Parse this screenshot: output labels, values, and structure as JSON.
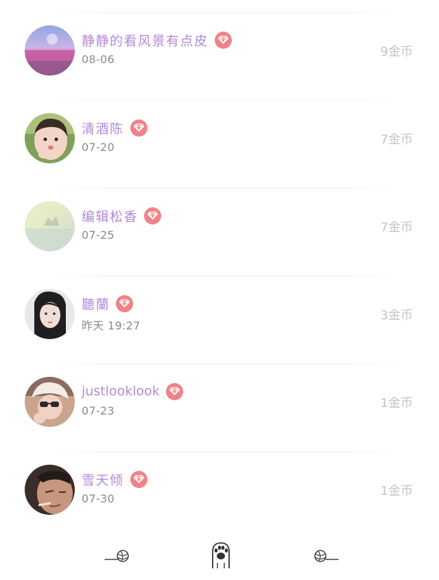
{
  "entries": [
    {
      "name": "静静的看风景有点皮",
      "date": "08-06",
      "coins": "9金币",
      "vip_icon": "diamond-icon"
    },
    {
      "name": "清酒陈",
      "date": "07-20",
      "coins": "7金币",
      "vip_icon": "diamond-icon"
    },
    {
      "name": "编辑松香",
      "date": "07-25",
      "coins": "7金币",
      "vip_icon": "diamond-icon"
    },
    {
      "name": "聽蘭",
      "date": "昨天 19:27",
      "coins": "3金币",
      "vip_icon": "diamond-icon"
    },
    {
      "name": "justlooklook",
      "date": "07-23",
      "coins": "1金币",
      "vip_icon": "diamond-icon"
    },
    {
      "name": "雪天倾",
      "date": "07-30",
      "coins": "1金币",
      "vip_icon": "diamond-icon"
    }
  ],
  "tabbar": {
    "left_icon": "yarn-ball-icon",
    "center_icon": "cat-paw-icon",
    "right_icon": "yarn-ball-icon"
  },
  "colors": {
    "name": "#b28ad6",
    "vip_badge": "#f08287",
    "date": "#8b8b8b",
    "coins": "#c4c4c4"
  }
}
